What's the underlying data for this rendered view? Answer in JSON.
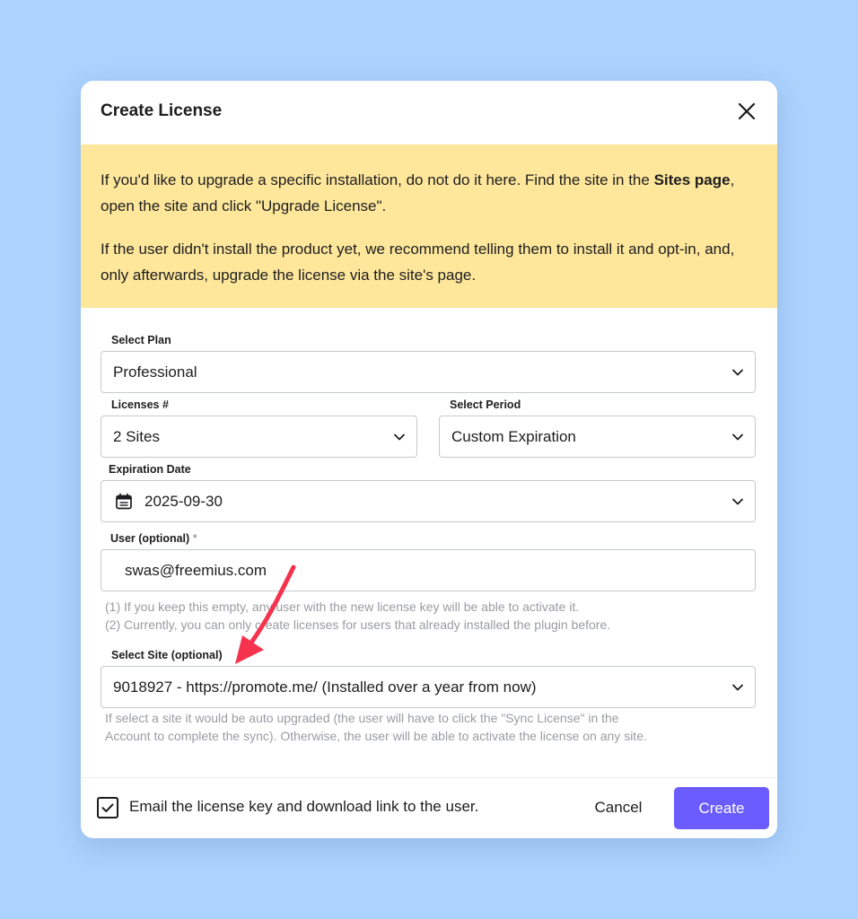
{
  "modal": {
    "title": "Create License"
  },
  "notice": {
    "p1_before": "If you'd like to upgrade a specific installation, do not do it here. Find the site in the ",
    "p1_bold": "Sites page",
    "p1_after": ", open the site and click \"Upgrade License\".",
    "p2": "If the user didn't install the product yet, we recommend telling them to install it and opt-in, and, only afterwards, upgrade the license via the site's page."
  },
  "form": {
    "plan": {
      "label": "Select Plan",
      "value": "Professional"
    },
    "licenses": {
      "label": "Licenses #",
      "value": "2 Sites"
    },
    "period": {
      "label": "Select Period",
      "value": "Custom Expiration"
    },
    "expiration": {
      "label": "Expiration Date",
      "value": "2025-09-30"
    },
    "user": {
      "label": "User (optional)",
      "required_mark": "*",
      "value": "swas@freemius.com",
      "hint1": "(1) If you keep this empty, any user with the new license key will be able to activate it.",
      "hint2": "(2) Currently, you can only create licenses for users that already installed the plugin before."
    },
    "site": {
      "label": "Select Site (optional)",
      "value": "9018927 - https://promote.me/ (Installed over a year from now)",
      "hint1": "If select a site it would be auto upgraded (the user will have to click the \"Sync License\" in the",
      "hint2": "Account to complete the sync). Otherwise, the user will be able to activate the license on any site."
    }
  },
  "footer": {
    "email_checkbox_label": "Email the license key and download link to the user.",
    "email_checked": true,
    "cancel_label": "Cancel",
    "create_label": "Create"
  },
  "colors": {
    "background": "#acd2fe",
    "notice": "#fee79b",
    "primary": "#6b5cff",
    "annotation_arrow": "#f5334f"
  },
  "icons": {
    "close": "close-icon",
    "chevron": "chevron-down-icon",
    "calendar": "calendar-icon",
    "check": "checkmark-icon"
  }
}
